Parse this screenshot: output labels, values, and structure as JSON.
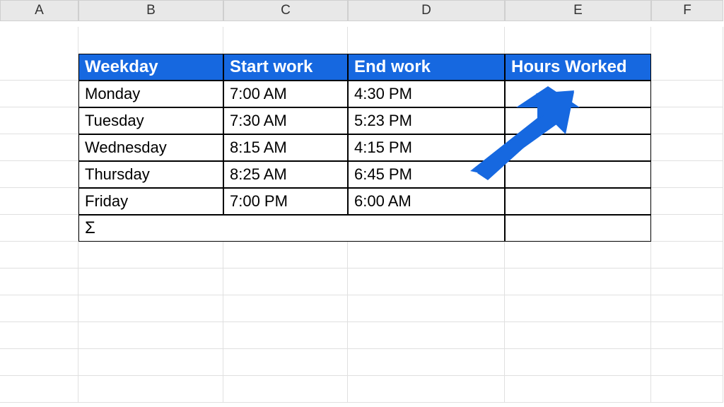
{
  "columns": [
    "A",
    "B",
    "C",
    "D",
    "E",
    "F"
  ],
  "table": {
    "headers": [
      "Weekday",
      "Start work",
      "End work",
      "Hours Worked"
    ],
    "rows": [
      {
        "weekday": "Monday",
        "start": "7:00 AM",
        "end": "4:30 PM",
        "hours": ""
      },
      {
        "weekday": "Tuesday",
        "start": "7:30 AM",
        "end": "5:23 PM",
        "hours": ""
      },
      {
        "weekday": "Wednesday",
        "start": "8:15 AM",
        "end": "4:15 PM",
        "hours": ""
      },
      {
        "weekday": "Thursday",
        "start": "8:25 AM",
        "end": "6:45 PM",
        "hours": ""
      },
      {
        "weekday": "Friday",
        "start": "7:00 PM",
        "end": "6:00 AM",
        "hours": ""
      }
    ],
    "sigma": "Σ",
    "total": ""
  },
  "colors": {
    "header_bg": "#1668e0",
    "header_fg": "#ffffff",
    "arrow": "#1668e0"
  }
}
